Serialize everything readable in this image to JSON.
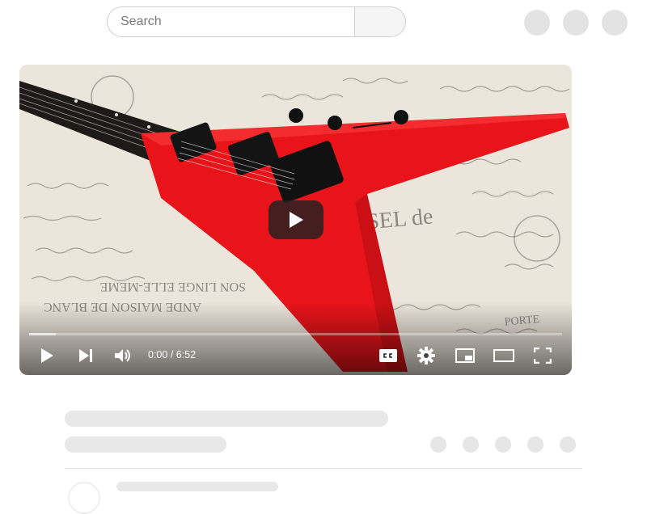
{
  "search": {
    "placeholder": "Search"
  },
  "player": {
    "time_current": "0:00",
    "time_separator": "/",
    "time_total": "6:52",
    "progress": 0.05,
    "icons": {
      "play": "play-icon",
      "next": "next-icon",
      "volume": "volume-icon",
      "captions": "closed-captions-icon",
      "settings": "gear-icon",
      "miniplayer": "miniplayer-icon",
      "theater": "theater-mode-icon",
      "fullscreen": "fullscreen-icon",
      "big_play": "big-play-icon"
    }
  },
  "colors": {
    "guitar": "#e8141a",
    "placeholder_gray": "#e3e3e3"
  }
}
